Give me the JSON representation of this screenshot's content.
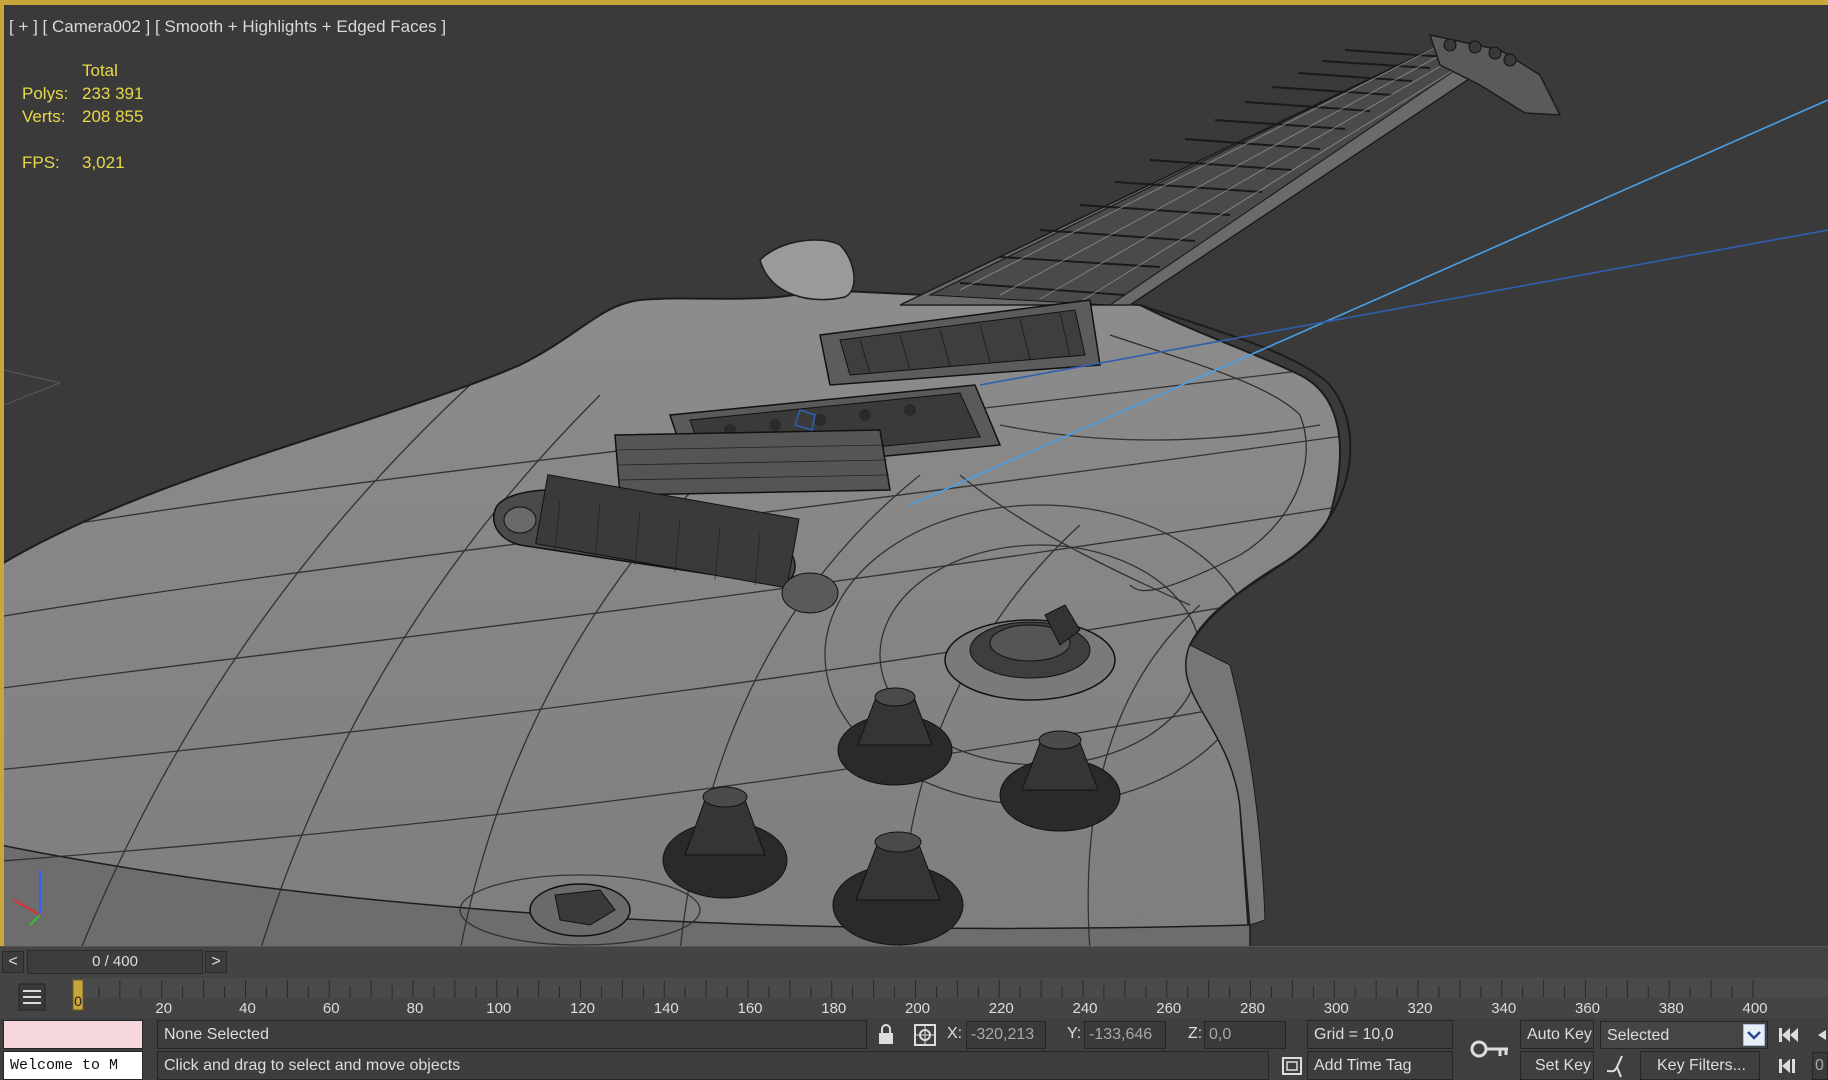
{
  "viewport": {
    "label": "[ + ] [ Camera002 ] [ Smooth + Highlights + Edged Faces ]",
    "stats": {
      "header": "Total",
      "polys_label": "Polys:",
      "polys_value": "233 391",
      "verts_label": "Verts:",
      "verts_value": "208 855",
      "fps_label": "FPS:",
      "fps_value": "3,021"
    }
  },
  "timeline": {
    "prev_label": "<",
    "next_label": ">",
    "frame_display": "0 / 400",
    "current_frame": 0,
    "start": 0,
    "end": 400,
    "ticks": [
      "0",
      "20",
      "40",
      "60",
      "80",
      "100",
      "120",
      "140",
      "160",
      "180",
      "200",
      "220",
      "240",
      "260",
      "280",
      "300",
      "320",
      "340",
      "360",
      "380",
      "400"
    ]
  },
  "status": {
    "listener_text": "Welcome to M",
    "selection_text": "None Selected",
    "prompt_text": "Click and drag to select and move objects",
    "x_label": "X:",
    "x_value": "-320,213",
    "y_label": "Y:",
    "y_value": "-133,646",
    "z_label": "Z:",
    "z_value": "0,0",
    "grid_text": "Grid = 10,0",
    "add_time_tag": "Add Time Tag",
    "auto_key": "Auto Key",
    "set_key": "Set Key",
    "key_mode": "Selected",
    "key_filters": "Key Filters...",
    "frame_field": "0"
  },
  "colors": {
    "accent": "#c9a63b",
    "stats_text": "#e8d84a",
    "viewport_bg": "#3a3a3a",
    "model_fill": "#8a8a8a",
    "wire": "#1e1e1e",
    "selection_line": "#4aa0e6"
  }
}
